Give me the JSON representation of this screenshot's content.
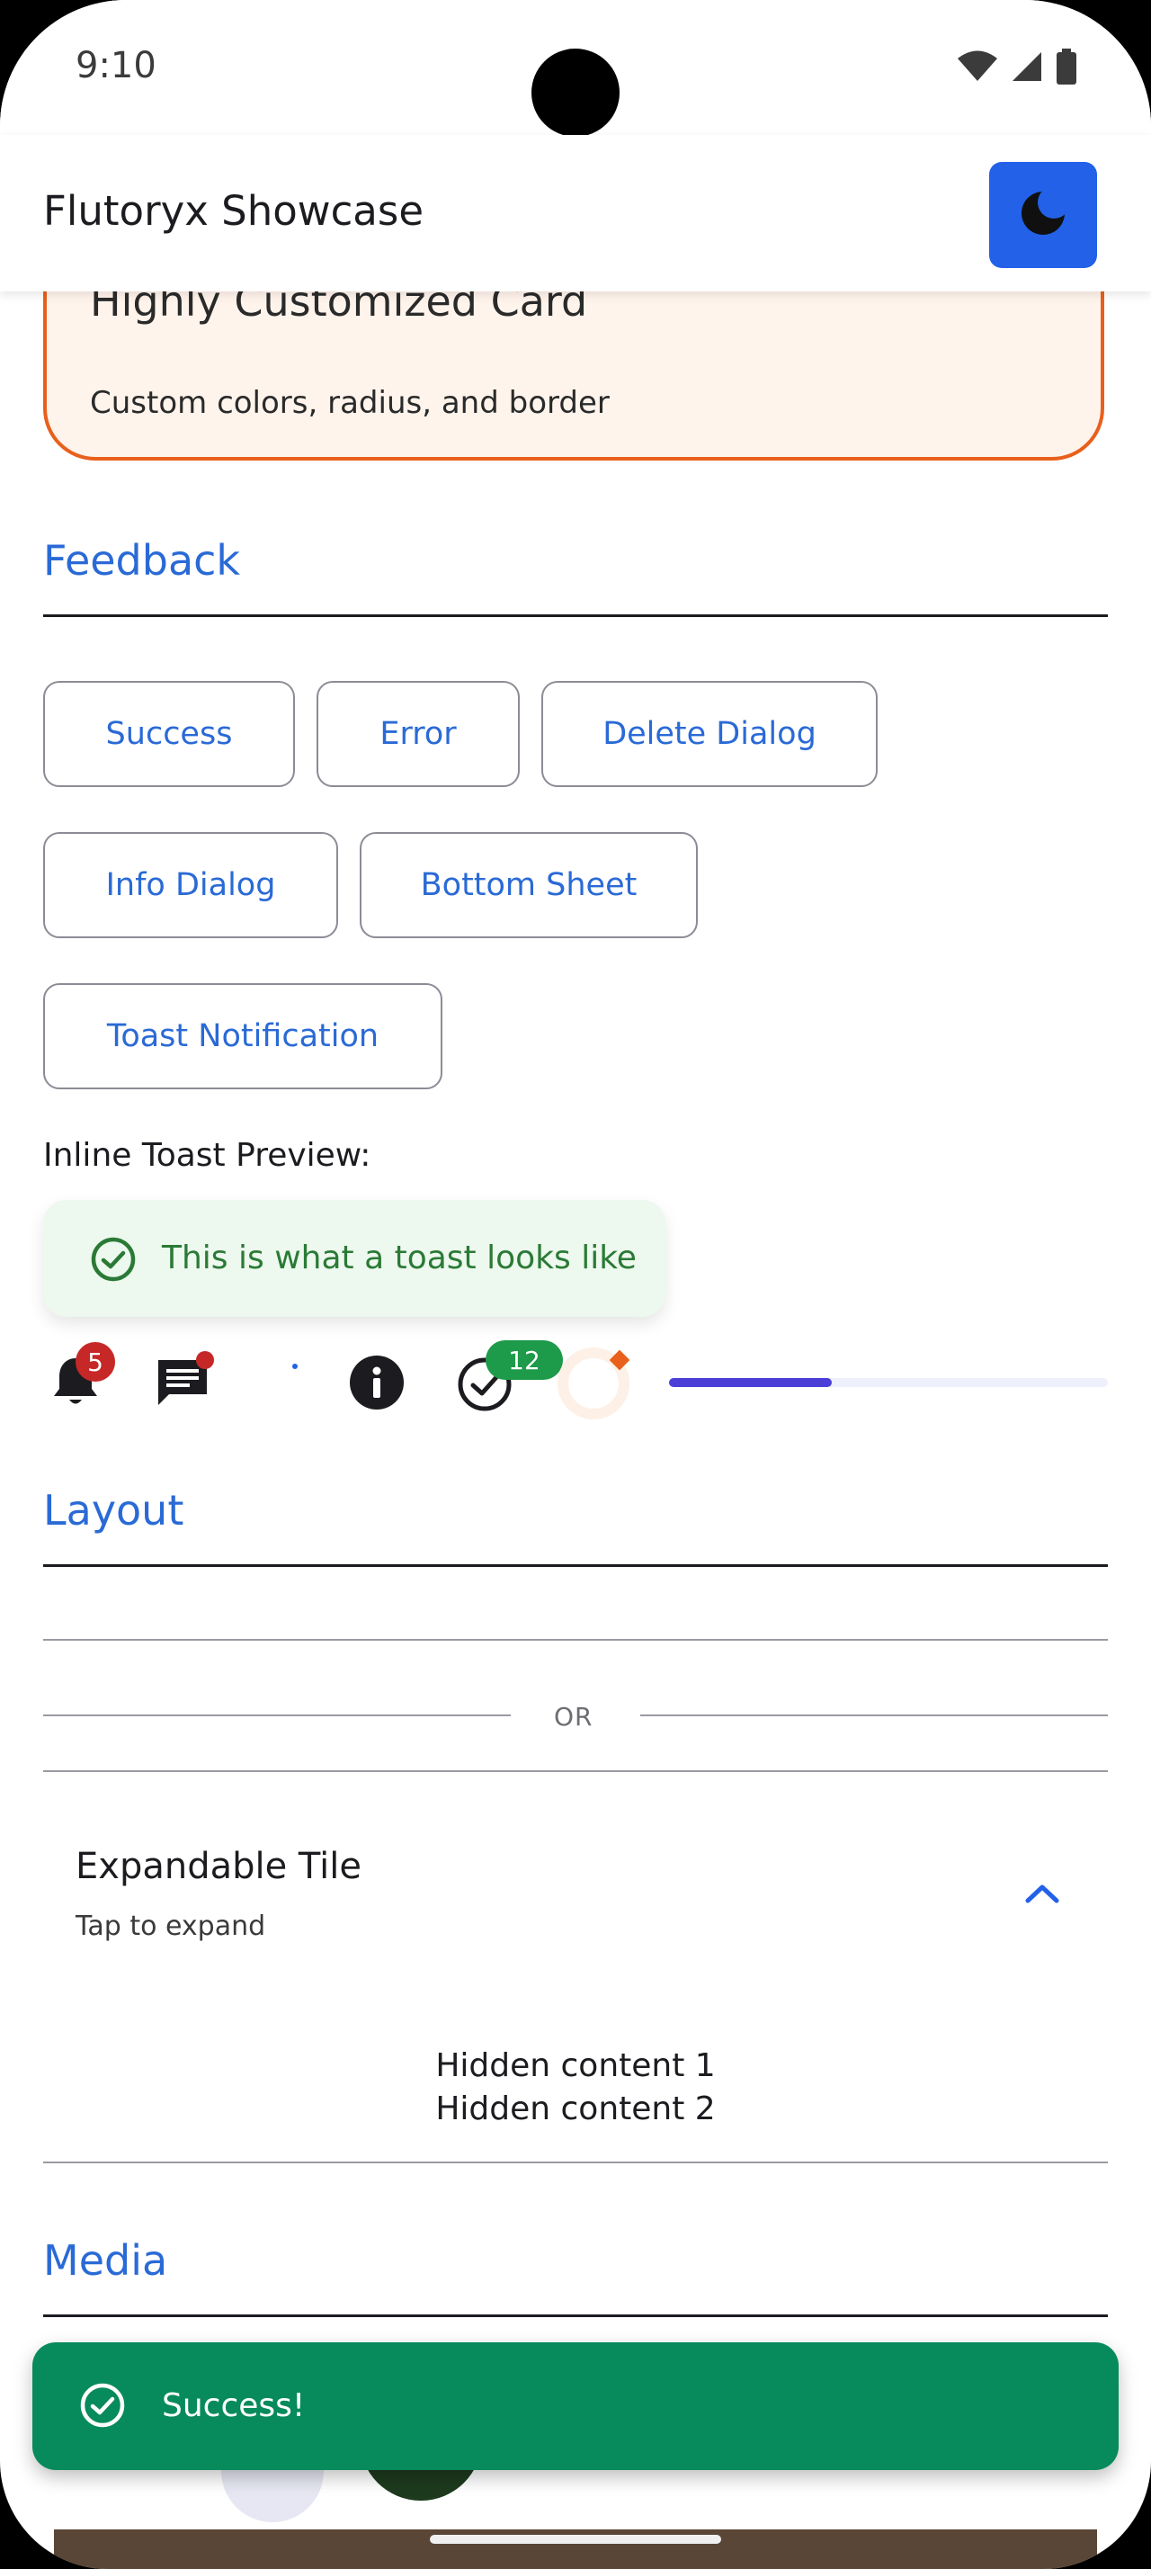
{
  "status_bar": {
    "time": "9:10"
  },
  "app_bar": {
    "title": "Flutoryx Showcase",
    "theme_toggle_icon": "moon-icon"
  },
  "custom_card": {
    "title": "Highly Customized Card",
    "subtitle": "Custom colors, radius, and border",
    "border_color": "#e8601c",
    "background": "#fff4ec"
  },
  "feedback": {
    "title": "Feedback",
    "buttons": [
      "Success",
      "Error",
      "Delete Dialog",
      "Info Dialog",
      "Bottom Sheet",
      "Toast Notification"
    ],
    "inline_label": "Inline Toast Preview:",
    "toast_text": "This is what a toast looks like",
    "badges": {
      "notifications": "5",
      "tasks": "12"
    },
    "progress": 0.37
  },
  "layout": {
    "title": "Layout",
    "divider_text": "OR",
    "expandable_tile": {
      "title": "Expandable Tile",
      "subtitle": "Tap to expand",
      "content": [
        "Hidden content 1",
        "Hidden content 2"
      ]
    }
  },
  "media": {
    "title": "Media"
  },
  "snackbar": {
    "text": "Success!",
    "background": "#078a5c"
  },
  "colors": {
    "accent": "#2a6ad6",
    "primary_button": "#2261e8",
    "success": "#2a7a36"
  }
}
